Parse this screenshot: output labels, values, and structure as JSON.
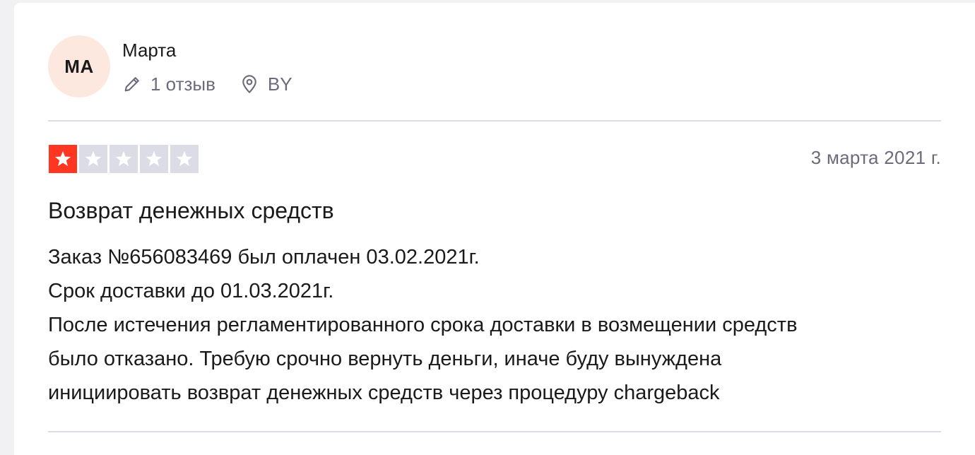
{
  "reviewer": {
    "initials": "MA",
    "name": "Марта",
    "reviews_count": "1 отзыв",
    "country": "BY",
    "icons": {
      "reviews": "pencil-icon",
      "location": "location-pin-icon"
    },
    "avatar_color": "#fce8df"
  },
  "review": {
    "rating": 1,
    "rating_max": 5,
    "date": "3 марта 2021 г.",
    "title": "Возврат денежных средств",
    "body_lines": [
      "Заказ №656083469 был оплачен 03.02.2021г.",
      "Срок доставки до 01.03.2021г.",
      "После истечения регламентированного срока доставки в возмещении средств",
      "было отказано. Требую срочно вернуть деньги, иначе буду вынуждена",
      "инициировать возврат денежных средств через процедуру chargeback"
    ]
  },
  "colors": {
    "star_filled": "#ff3722",
    "star_empty": "#dcdce6",
    "muted_text": "#6b6b7b"
  }
}
